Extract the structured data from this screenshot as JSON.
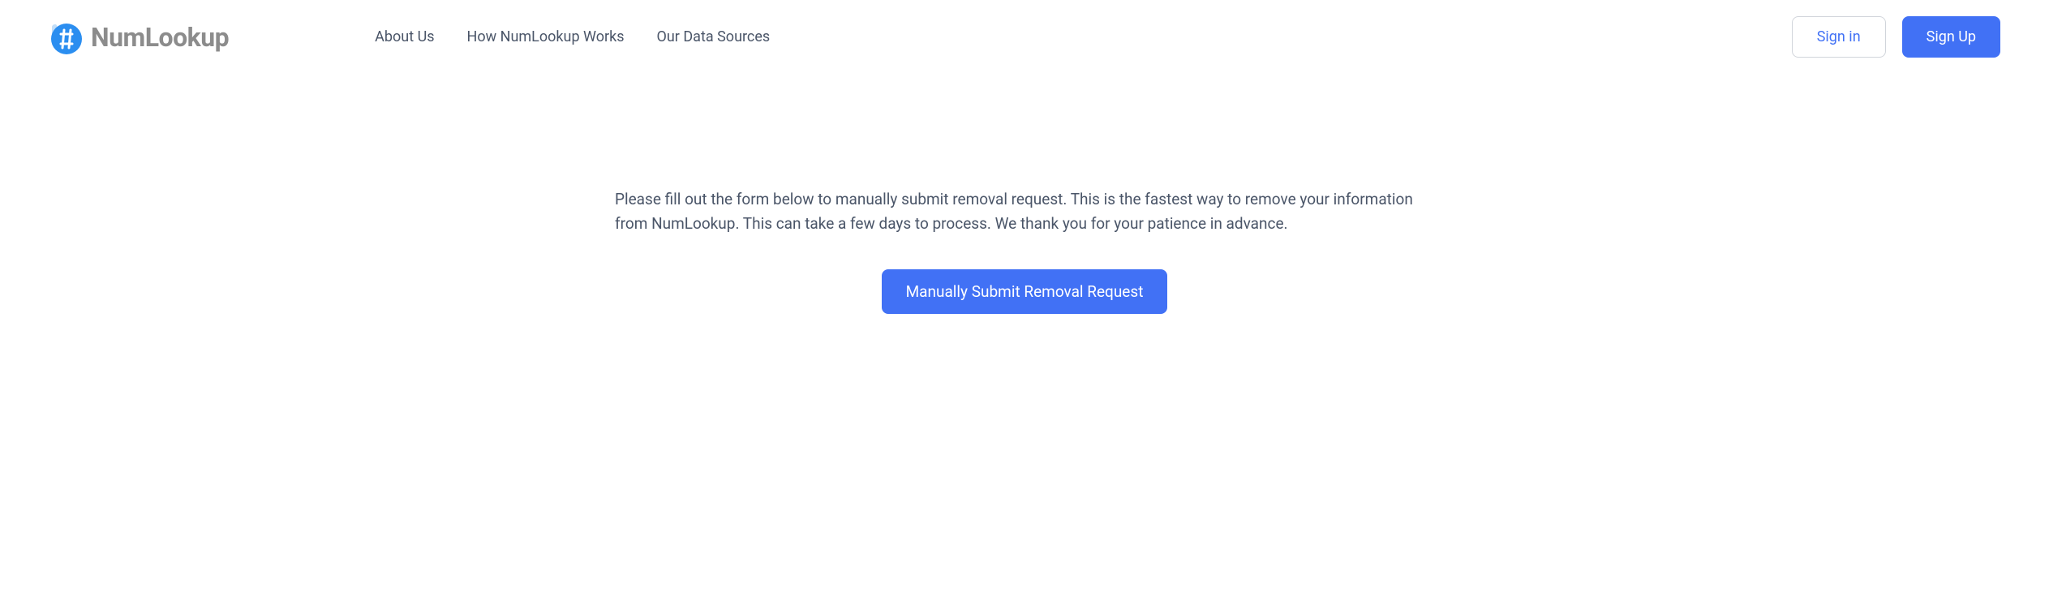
{
  "logo": {
    "text": "NumLookup"
  },
  "nav": {
    "about": "About Us",
    "how": "How NumLookup Works",
    "sources": "Our Data Sources"
  },
  "auth": {
    "signin": "Sign in",
    "signup": "Sign Up"
  },
  "content": {
    "description": "Please fill out the form below to manually submit removal request. This is the fastest way to remove your information from NumLookup. This can take a few days to process. We thank you for your patience in advance.",
    "cta": "Manually Submit Removal Request"
  },
  "colors": {
    "primary": "#4171f5",
    "textMuted": "#4a5568",
    "logoGray": "#8c8c8c"
  }
}
